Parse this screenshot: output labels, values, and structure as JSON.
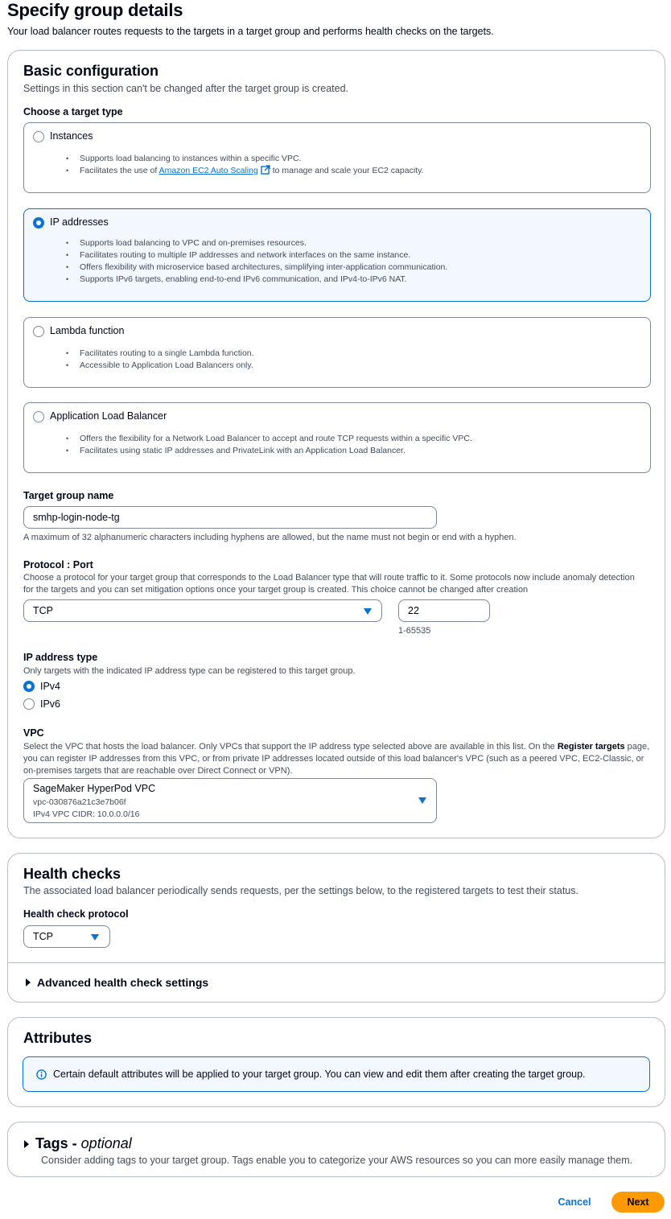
{
  "header": {
    "title": "Specify group details",
    "description": "Your load balancer routes requests to the targets in a target group and performs health checks on the targets."
  },
  "basic": {
    "title": "Basic configuration",
    "description": "Settings in this section can't be changed after the target group is created.",
    "target_type_label": "Choose a target type",
    "target_types": [
      {
        "label": "Instances",
        "selected": false,
        "bullets": [
          "Supports load balancing to instances within a specific VPC."
        ],
        "link_bullet": {
          "prefix": "Facilitates the use of ",
          "link": "Amazon EC2 Auto Scaling",
          "suffix": " to manage and scale your EC2 capacity."
        }
      },
      {
        "label": "IP addresses",
        "selected": true,
        "bullets": [
          "Supports load balancing to VPC and on-premises resources.",
          "Facilitates routing to multiple IP addresses and network interfaces on the same instance.",
          "Offers flexibility with microservice based architectures, simplifying inter-application communication.",
          "Supports IPv6 targets, enabling end-to-end IPv6 communication, and IPv4-to-IPv6 NAT."
        ]
      },
      {
        "label": "Lambda function",
        "selected": false,
        "bullets": [
          "Facilitates routing to a single Lambda function.",
          "Accessible to Application Load Balancers only."
        ]
      },
      {
        "label": "Application Load Balancer",
        "selected": false,
        "bullets": [
          "Offers the flexibility for a Network Load Balancer to accept and route TCP requests within a specific VPC.",
          "Facilitates using static IP addresses and PrivateLink with an Application Load Balancer."
        ]
      }
    ],
    "tg_name": {
      "label": "Target group name",
      "value": "smhp-login-node-tg",
      "hint": "A maximum of 32 alphanumeric characters including hyphens are allowed, but the name must not begin or end with a hyphen."
    },
    "protocol_port": {
      "label": "Protocol : Port",
      "description": "Choose a protocol for your target group that corresponds to the Load Balancer type that will route traffic to it. Some protocols now include anomaly detection for the targets and you can set mitigation options once your target group is created. This choice cannot be changed after creation",
      "protocol": "TCP",
      "port": "22",
      "port_hint": "1-65535"
    },
    "ip_type": {
      "label": "IP address type",
      "description": "Only targets with the indicated IP address type can be registered to this target group.",
      "options": [
        {
          "label": "IPv4",
          "selected": true
        },
        {
          "label": "IPv6",
          "selected": false
        }
      ]
    },
    "vpc": {
      "label": "VPC",
      "desc_part1": "Select the VPC that hosts the load balancer. Only VPCs that support the IP address type selected above are available in this list. On the ",
      "desc_bold": "Register targets",
      "desc_part2": " page, you can register IP addresses from this VPC, or from private IP addresses located outside of this load balancer's VPC (such as a peered VPC, EC2-Classic, or on-premises targets that are reachable over Direct Connect or VPN).",
      "name": "SageMaker HyperPod VPC",
      "id": "vpc-030876a21c3e7b06f",
      "cidr": "IPv4 VPC CIDR: 10.0.0.0/16"
    }
  },
  "health": {
    "title": "Health checks",
    "description": "The associated load balancer periodically sends requests, per the settings below, to the registered targets to test their status.",
    "protocol_label": "Health check protocol",
    "protocol": "TCP",
    "advanced": "Advanced health check settings"
  },
  "attributes": {
    "title": "Attributes",
    "info": "Certain default attributes will be applied to your target group. You can view and edit them after creating the target group."
  },
  "tags": {
    "title": "Tags - ",
    "title_optional": "optional",
    "description": "Consider adding tags to your target group. Tags enable you to categorize your AWS resources so you can more easily manage them."
  },
  "footer": {
    "cancel": "Cancel",
    "next": "Next"
  },
  "colors": {
    "accent": "#0972d3",
    "primary_button": "#ff9900",
    "selected_tile_bg": "#f2f8fd"
  }
}
